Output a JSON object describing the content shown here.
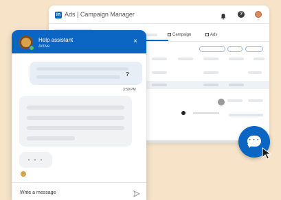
{
  "colors": {
    "background": "#F6E3C8",
    "brand_blue": "#0a66c2",
    "online_green": "#57c05b"
  },
  "campaign_manager": {
    "logo_text": "in",
    "title": "Ads | Campaign Manager",
    "icons": [
      "bell-icon",
      "help-icon",
      "avatar"
    ],
    "tabs": [
      {
        "label": "Campaign",
        "icon": "grid-icon"
      },
      {
        "label": "Ads",
        "icon": "grid-icon"
      }
    ]
  },
  "chat": {
    "title": "Help assistant",
    "status": "Active",
    "close_icon": "×",
    "user_message_tail": "?",
    "timestamp": "3:39 PM",
    "typing_indicator": "• • •",
    "input_placeholder": "Write a message",
    "send_icon": "send-icon"
  },
  "launcher": {
    "icon": "chat-bubble-icon",
    "dots": "• • •"
  }
}
